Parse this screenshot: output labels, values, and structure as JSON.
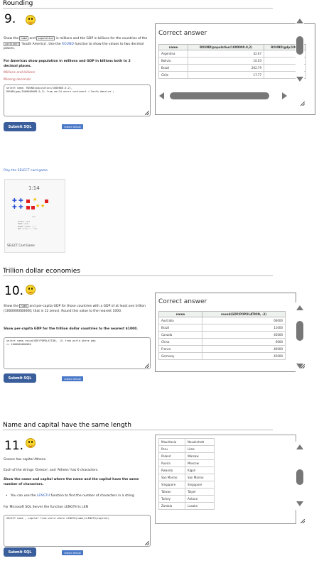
{
  "sections": {
    "rounding": {
      "title": "Rounding"
    },
    "trillion": {
      "title": "Trillion dollar economies"
    },
    "capital": {
      "title": "Name and capital have the same length"
    }
  },
  "q9": {
    "number": "9.",
    "intro_1": "Show the",
    "intro_code1": "name",
    "intro_2": "and",
    "intro_code2": "population",
    "intro_3": "in millions and the GDP in billions for the",
    "intro_4": "countries of the",
    "intro_code3": "continent",
    "intro_5": "'South America'. Use the",
    "intro_link": "ROUND",
    "intro_6": "function to show",
    "intro_7": "the values to two decimal places.",
    "bold_text": "For Americas show population in millions and GDP in billions both to 2 decimal places.",
    "hint1": "Millions and billions",
    "hint2": "Missing decimals",
    "sql": "select name, ROUND(population/1000000.0,2),\nROUND(gdp/1000000000.0,2) from world where continent ='South America';",
    "submit_label": "Submit SQL",
    "restore_label": "restore default",
    "result_title": "Correct answer",
    "columns": [
      "name",
      "ROUND(population/1000000.0,2)",
      "ROUND(gdp/1000"
    ],
    "rows": [
      [
        "Argentina",
        "42.67",
        ""
      ],
      [
        "Bolivia",
        "10.03",
        ""
      ],
      [
        "Brazil",
        "202.79",
        ""
      ],
      [
        "Chile",
        "17.77",
        ""
      ]
    ]
  },
  "card_game": {
    "link": "Play the SELECT card game",
    "timer": "1:14",
    "score": "0/0",
    "code_text": "SELECT card\nFROM cards\nWHERE number = 1\nAND colour = 'red'",
    "caption": "SELECT Card Game"
  },
  "q10": {
    "number": "10.",
    "intro_1": "Show the",
    "intro_code1": "name",
    "intro_2": "and per-capita GDP for those countries with a GDP of at least",
    "intro_3": "one trillion (1000000000000; that is 12 zeros). Round this value to the nearest",
    "intro_4": "1000.",
    "bold_text": "Show per-capita GDP for the trillion dollar countries to the nearest $1000.",
    "sql": "select name,round(GDP/POPULATION, -3) from world where gdp\n>= 1000000000000",
    "submit_label": "Submit SQL",
    "restore_label": "restore default",
    "result_title": "Correct answer",
    "columns": [
      "name",
      "round(GDP/POPULATION, -3)"
    ],
    "rows": [
      [
        "Australia",
        "66000"
      ],
      [
        "Brazil",
        "11000"
      ],
      [
        "Canada",
        "45000"
      ],
      [
        "China",
        "6000"
      ],
      [
        "France",
        "40000"
      ],
      [
        "Germany",
        "42000"
      ]
    ]
  },
  "q11": {
    "number": "11.",
    "line1": "Greece has capital Athens.",
    "line2": "Each of the strings 'Greece', and 'Athens' has 6 characters.",
    "bold_text": "Show the name and capital where the name and the capital have the same number of characters.",
    "bullet_1": "You can use the",
    "bullet_link": "LENGTH",
    "bullet_2": "function to find the number of characters in a string",
    "note": "For Microsoft SQL Server the function LENGTH is LEN",
    "sql": "SELECT name , capital from world where LENGTH(name)=LENGTH(capital)",
    "submit_label": "Submit SQL",
    "restore_label": "restore default",
    "rows": [
      [
        "Mauritania",
        "Nouakchott"
      ],
      [
        "Peru",
        "Lima"
      ],
      [
        "Poland",
        "Warsaw"
      ],
      [
        "Russia",
        "Moscow"
      ],
      [
        "Rwanda",
        "Kigali"
      ],
      [
        "San Marino",
        "San Marino"
      ],
      [
        "Singapore",
        "Singapore"
      ],
      [
        "Taiwan",
        "Taipei"
      ],
      [
        "Turkey",
        "Ankara"
      ],
      [
        "Zambia",
        "Lusaka"
      ]
    ]
  },
  "colors": {
    "submit": "#3a5e9c",
    "link": "#3060c0",
    "scrollbar": "#777777"
  }
}
